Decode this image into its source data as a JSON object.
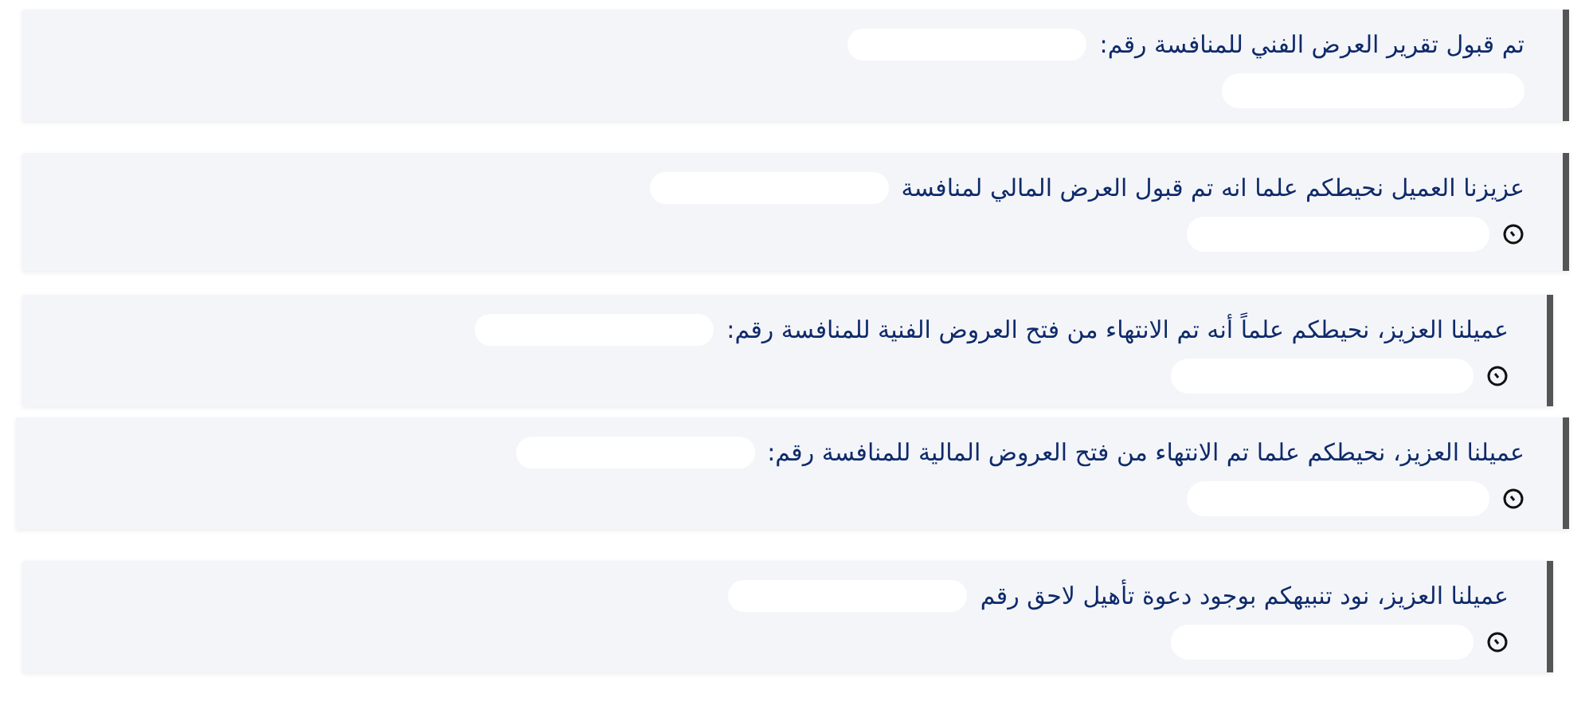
{
  "notifications": [
    {
      "message": "تم قبول تقرير العرض الفني للمنافسة رقم:",
      "time_icon": false
    },
    {
      "message": "عزيزنا العميل نحيطكم علما انه تم قبول العرض المالي لمنافسة",
      "time_icon": true
    },
    {
      "message": "عميلنا العزيز، نحيطكم علماً أنه تم الانتهاء من فتح العروض الفنية للمنافسة رقم:",
      "time_icon": true
    },
    {
      "message": "عميلنا العزيز، نحيطكم علما تم الانتهاء من فتح العروض المالية للمنافسة رقم:",
      "time_icon": true
    },
    {
      "message": "عميلنا العزيز، نود تنبيهكم بوجود دعوة تأهيل لاحق رقم",
      "time_icon": true
    }
  ]
}
